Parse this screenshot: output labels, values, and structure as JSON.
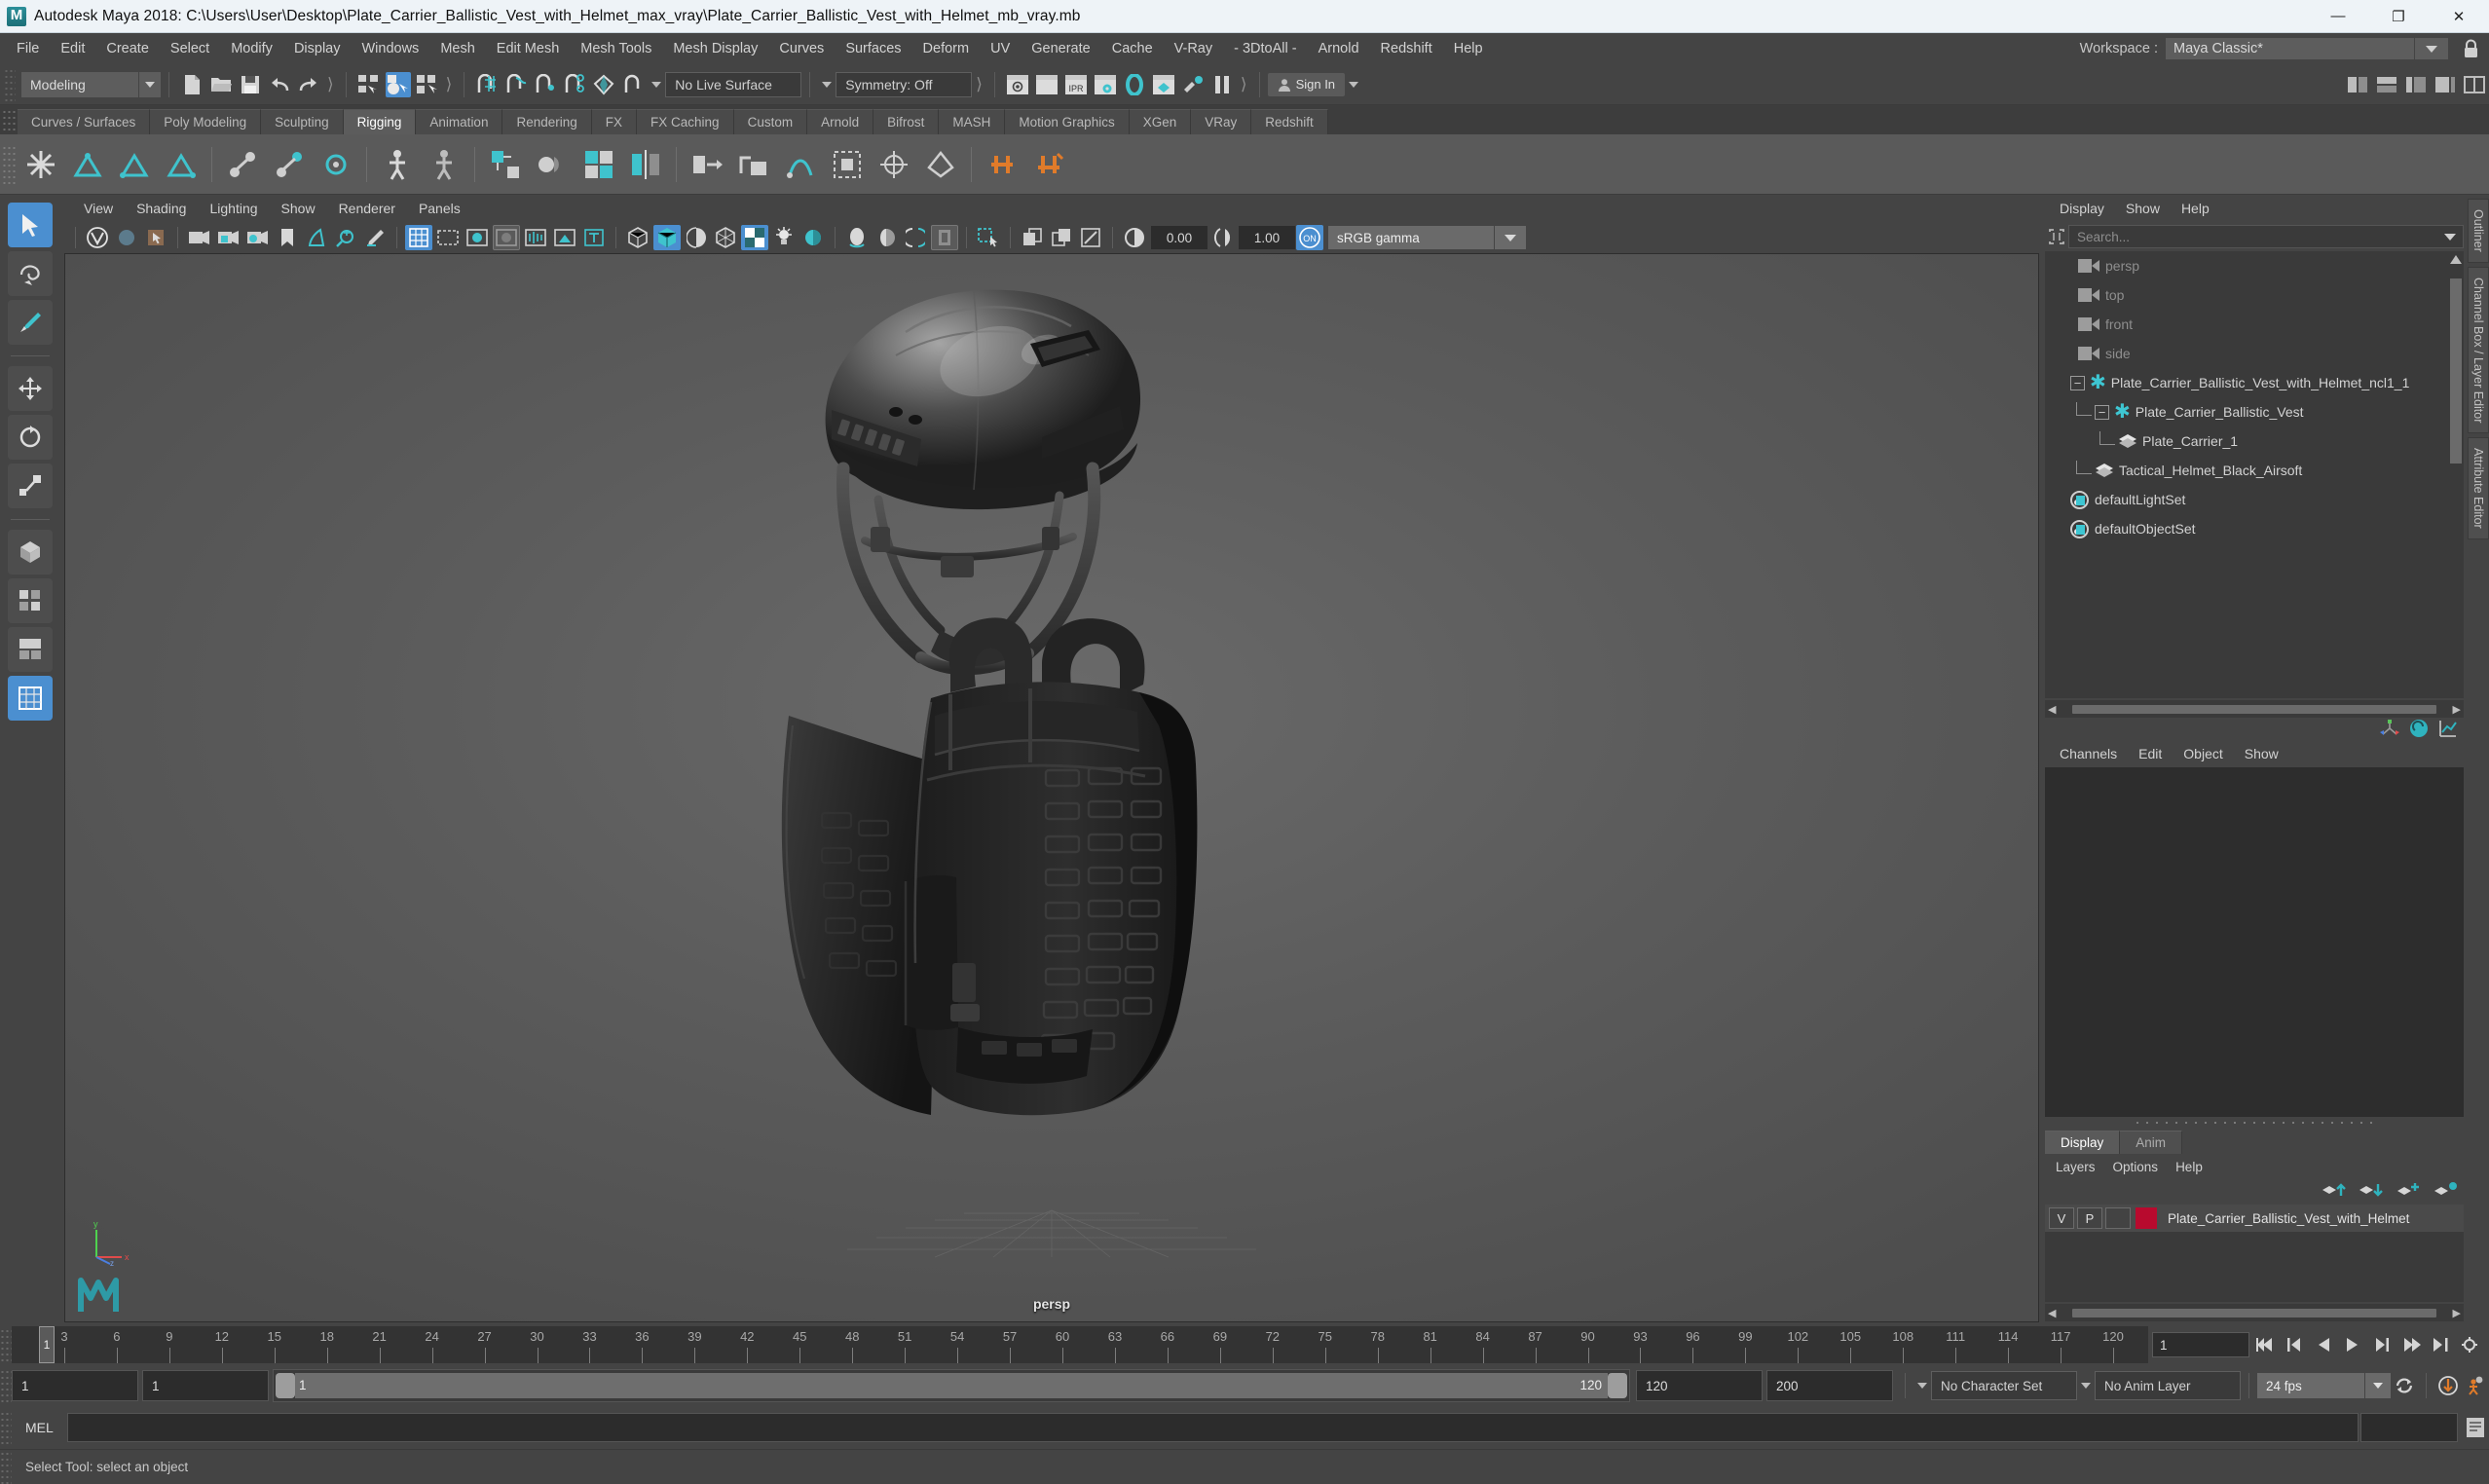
{
  "window": {
    "title": "Autodesk Maya 2018: C:\\Users\\User\\Desktop\\Plate_Carrier_Ballistic_Vest_with_Helmet_max_vray\\Plate_Carrier_Ballistic_Vest_with_Helmet_mb_vray.mb",
    "minimize": "—",
    "maximize": "❐",
    "close": "✕",
    "logo_letter": "M"
  },
  "menubar": {
    "items": [
      "File",
      "Edit",
      "Create",
      "Select",
      "Modify",
      "Display",
      "Windows",
      "Mesh",
      "Edit Mesh",
      "Mesh Tools",
      "Mesh Display",
      "Curves",
      "Surfaces",
      "Deform",
      "UV",
      "Generate",
      "Cache",
      "V-Ray",
      "- 3DtoAll -",
      "Arnold",
      "Redshift",
      "Help"
    ],
    "workspace_label": "Workspace :",
    "workspace_value": "Maya Classic*"
  },
  "statusline": {
    "menuset": "Modeling",
    "live_surface": "No Live Surface",
    "symmetry": "Symmetry: Off",
    "signin": "Sign In"
  },
  "shelf": {
    "tabs": [
      {
        "label": "Curves / Surfaces",
        "selected": false
      },
      {
        "label": "Poly Modeling",
        "selected": false
      },
      {
        "label": "Sculpting",
        "selected": false
      },
      {
        "label": "Rigging",
        "selected": true
      },
      {
        "label": "Animation",
        "selected": false
      },
      {
        "label": "Rendering",
        "selected": false
      },
      {
        "label": "FX",
        "selected": false
      },
      {
        "label": "FX Caching",
        "selected": false
      },
      {
        "label": "Custom",
        "selected": false
      },
      {
        "label": "Arnold",
        "selected": false
      },
      {
        "label": "Bifrost",
        "selected": false
      },
      {
        "label": "MASH",
        "selected": false
      },
      {
        "label": "Motion Graphics",
        "selected": false
      },
      {
        "label": "XGen",
        "selected": false
      },
      {
        "label": "VRay",
        "selected": false
      },
      {
        "label": "Redshift",
        "selected": false
      }
    ]
  },
  "viewport": {
    "menus": [
      "View",
      "Shading",
      "Lighting",
      "Show",
      "Renderer",
      "Panels"
    ],
    "exposure": "0.00",
    "gamma_value": "1.00",
    "color_management": "sRGB gamma",
    "cm_toggle": "ON",
    "camera_label": "persp",
    "axis_x": "x",
    "axis_y": "y",
    "axis_z": "z"
  },
  "outliner": {
    "tab_label": "Outliner",
    "menus": [
      "Display",
      "Show",
      "Help"
    ],
    "search_placeholder": "Search...",
    "items": [
      {
        "label": "persp",
        "icon": "camera-icon",
        "depth": 1,
        "dim": true,
        "expander": null
      },
      {
        "label": "top",
        "icon": "camera-icon",
        "depth": 1,
        "dim": true,
        "expander": null
      },
      {
        "label": "front",
        "icon": "camera-icon",
        "depth": 1,
        "dim": true,
        "expander": null
      },
      {
        "label": "side",
        "icon": "camera-icon",
        "depth": 1,
        "dim": true,
        "expander": null
      },
      {
        "label": "Plate_Carrier_Ballistic_Vest_with_Helmet_ncl1_1",
        "icon": "nucleus-icon",
        "depth": 0,
        "dim": false,
        "expander": "−"
      },
      {
        "label": "Plate_Carrier_Ballistic_Vest",
        "icon": "nucleus-icon",
        "depth": 1,
        "dim": false,
        "expander": "−"
      },
      {
        "label": "Plate_Carrier_1",
        "icon": "mesh-icon",
        "depth": 2,
        "dim": false,
        "expander": null
      },
      {
        "label": "Tactical_Helmet_Black_Airsoft",
        "icon": "mesh-icon",
        "depth": 1,
        "dim": false,
        "expander": null
      },
      {
        "label": "defaultLightSet",
        "icon": "set-icon",
        "depth": 0,
        "dim": false,
        "expander": null
      },
      {
        "label": "defaultObjectSet",
        "icon": "set-icon",
        "depth": 0,
        "dim": false,
        "expander": null
      }
    ]
  },
  "channelbox": {
    "tab_label": "Channel Box / Layer Editor",
    "attr_tab_label": "Attribute Editor",
    "menus": [
      "Channels",
      "Edit",
      "Object",
      "Show"
    ]
  },
  "layereditor": {
    "tabs": [
      {
        "label": "Display",
        "selected": true
      },
      {
        "label": "Anim",
        "selected": false
      }
    ],
    "menus": [
      "Layers",
      "Options",
      "Help"
    ],
    "layers": [
      {
        "visible": "V",
        "playback": "P",
        "type": "",
        "color": "#b80a2e",
        "name": "Plate_Carrier_Ballistic_Vest_with_Helmet"
      }
    ]
  },
  "timeline": {
    "ticks": [
      3,
      6,
      9,
      12,
      15,
      18,
      21,
      24,
      27,
      30,
      33,
      36,
      39,
      42,
      45,
      48,
      51,
      54,
      57,
      60,
      63,
      66,
      69,
      72,
      75,
      78,
      81,
      84,
      87,
      90,
      93,
      96,
      99,
      102,
      105,
      108,
      111,
      114,
      117,
      120
    ],
    "current_frame_marker": "1",
    "current_frame_field": "1",
    "range_start_field": "1",
    "range_start_inner": "1",
    "range_bar_start": "1",
    "range_bar_end": "120",
    "range_end_inner": "120",
    "range_end_field": "200",
    "character_set": "No Character Set",
    "anim_layer": "No Anim Layer",
    "fps": "24 fps"
  },
  "command": {
    "label": "MEL",
    "input_value": ""
  },
  "status": {
    "help_text": "Select Tool: select an object"
  },
  "colors": {
    "accent_blue": "#4b8fd0",
    "teal": "#31bec8",
    "layer_red": "#b80a2e",
    "orange": "#e07b2a",
    "titlebar_bg": "#eef3f7",
    "panel_bg": "#444444",
    "field_bg": "#2c2c2c"
  }
}
